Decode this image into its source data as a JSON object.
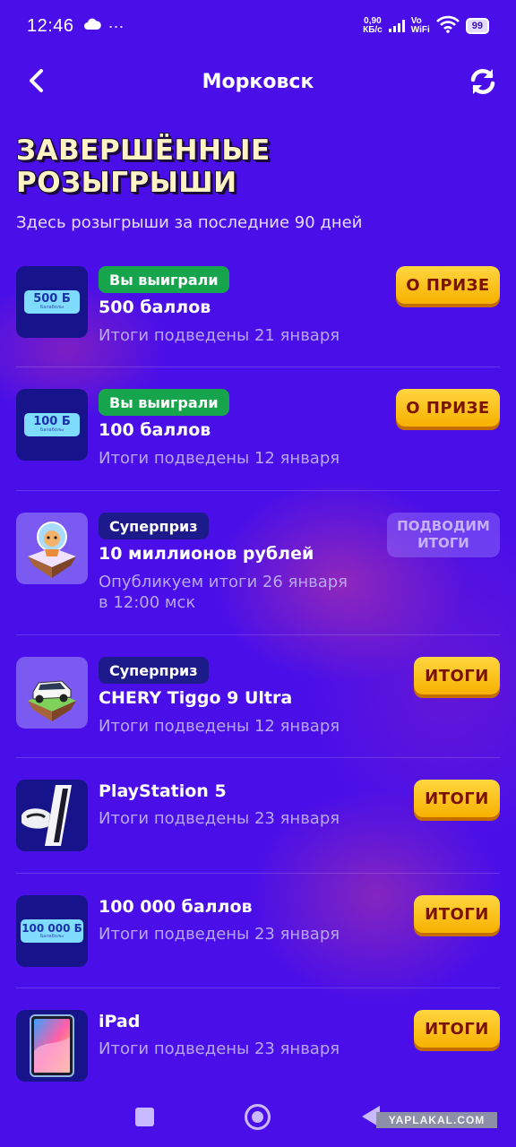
{
  "status_bar": {
    "time": "12:46",
    "net_speed_value": "0,90",
    "net_speed_unit": "КБ/с",
    "vowifi_top": "Vo",
    "vowifi_bottom": "WiFi",
    "battery": "99"
  },
  "header": {
    "title": "Морковск"
  },
  "page": {
    "heading_line1": "ЗАВЕРШЁННЫЕ",
    "heading_line2": "РОЗЫГРЫШИ",
    "subtitle": "Здесь розыгрыши за последние 90 дней"
  },
  "items": [
    {
      "badge": "Вы выиграли",
      "title": "500 баллов",
      "note": "Итоги подведены 21 января",
      "button": "О ПРИЗЕ",
      "thumb_text": "500 Б",
      "thumb_sub": "Балаболы"
    },
    {
      "badge": "Вы выиграли",
      "title": "100 баллов",
      "note": "Итоги подведены 12 января",
      "button": "О ПРИЗЕ",
      "thumb_text": "100 Б",
      "thumb_sub": "Балаболы"
    },
    {
      "badge": "Суперприз",
      "title": "10 миллионов рублей",
      "note_line1": "Опубликуем итоги 26 января",
      "note_line2": "в 12:00 мск",
      "button_line1": "ПОДВОДИМ",
      "button_line2": "ИТОГИ"
    },
    {
      "badge": "Суперприз",
      "title": "CHERY Tiggo 9 Ultra",
      "note": "Итоги подведены 12 января",
      "button": "ИТОГИ"
    },
    {
      "title": "PlayStation 5",
      "note": "Итоги подведены 23 января",
      "button": "ИТОГИ"
    },
    {
      "title": "100 000 баллов",
      "note": "Итоги подведены 23 января",
      "button": "ИТОГИ",
      "thumb_text": "100 000 Б",
      "thumb_sub": "Балаболы"
    },
    {
      "title": "iPad",
      "note": "Итоги подведены 23 января",
      "button": "ИТОГИ"
    }
  ],
  "watermark": "YAPLAKAL.COM",
  "colors": {
    "background": "#4a0fe8",
    "win_badge": "#16a54c",
    "super_badge": "#1d1a8c",
    "button_yellow": "#ffc61a",
    "button_text": "#7a1300",
    "note_text": "#b8a7f5"
  }
}
